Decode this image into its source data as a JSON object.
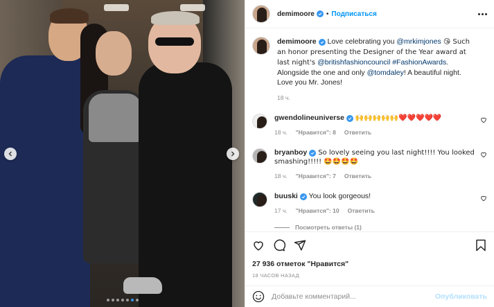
{
  "post": {
    "author": "demimoore",
    "follow_label": "Подписаться",
    "separator": "•",
    "caption": {
      "intro": "Love celebrating you ",
      "mention1": "@mrkimjones",
      "after_mention1": " 😘 Such an honor presenting the Designer of the Year award at last night's ",
      "mention2": "@britishfashioncouncil",
      "space": " ",
      "hashtag": "#FashionAwards",
      "after_hashtag": ". Alongside the one and only ",
      "mention3": "@tomdaley",
      "outro": "! A beautiful night. Love you Mr. Jones!",
      "time": "18 ч."
    },
    "comments": [
      {
        "user": "gwendolineuniverse",
        "text": "🙌🙌🙌🙌🙌❤️❤️❤️❤️❤️",
        "time": "18 ч.",
        "likes": "\"Нравится\": 8",
        "reply": "Ответить"
      },
      {
        "user": "bryanboy",
        "text": "So lovely seeing you last night!!!! You looked smashing!!!!! 🤩🤩🤩🤩",
        "time": "18 ч.",
        "likes": "\"Нравится\": 7",
        "reply": "Ответить"
      },
      {
        "user": "buuski",
        "text": "You look gorgeous!",
        "time": "17 ч.",
        "likes": "\"Нравится\": 10",
        "reply": "Ответить"
      }
    ],
    "view_replies": "Посмотреть ответы (1)",
    "likes_count": "27 936 отметок \"Нравится\"",
    "posted_ago": "18 ЧАСОВ НАЗАД",
    "comment_placeholder": "Добавьте комментарий...",
    "publish_label": "Опубликовать"
  },
  "carousel": {
    "slides": 7,
    "active_slide": 5
  },
  "colors": {
    "accent": "#0095f6",
    "verified": "#3897f0",
    "muted": "#8e8e8e",
    "publish_disabled": "#b2dffc"
  },
  "icons": [
    "chevron-left-icon",
    "chevron-right-icon",
    "more-icon",
    "verified-icon",
    "heart-icon",
    "comment-icon",
    "share-icon",
    "bookmark-icon",
    "emoji-icon"
  ]
}
